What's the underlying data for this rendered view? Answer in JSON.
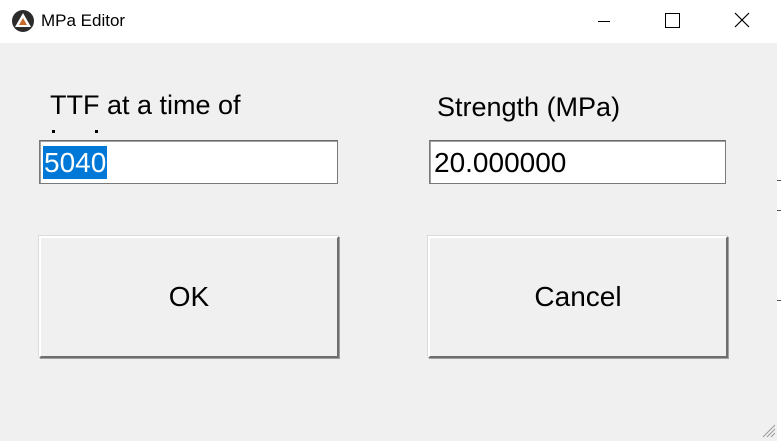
{
  "window": {
    "title": "MPa Editor",
    "icon": "app-triangle-icon",
    "controls": [
      "minimize-icon",
      "maximize-icon",
      "close-icon"
    ]
  },
  "form": {
    "ttf_label": "TTF at a time of",
    "strength_label": "Strength (MPa)",
    "ttf_value": "5040",
    "strength_value": "20.000000"
  },
  "buttons": {
    "ok": "OK",
    "cancel": "Cancel"
  },
  "colors": {
    "dialog_bg": "#f0f0f0",
    "selection": "#0078d7"
  }
}
